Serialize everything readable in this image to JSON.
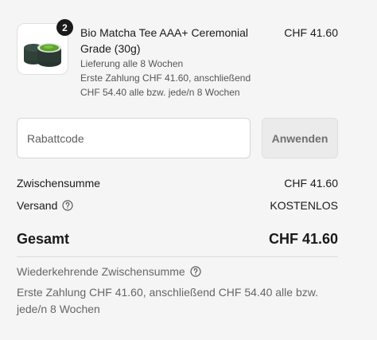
{
  "line_item": {
    "quantity": "2",
    "title": "Bio Matcha Tee AAA+ Ceremonial Grade (30g)",
    "delivery": "Lieferung alle 8 Wochen",
    "payment_line1": "Erste Zahlung CHF 41.60, anschließend",
    "payment_line2": "CHF 54.40 alle bzw. jede/n 8 Wochen",
    "price": "CHF 41.60",
    "image_icon": "matcha-tin-icon"
  },
  "discount": {
    "placeholder": "Rabattcode",
    "value": "",
    "apply_label": "Anwenden"
  },
  "summary": {
    "subtotal_label": "Zwischensumme",
    "subtotal_value": "CHF 41.60",
    "shipping_label": "Versand",
    "shipping_value": "KOSTENLOS",
    "total_label": "Gesamt",
    "total_value": "CHF 41.60"
  },
  "recurring": {
    "label": "Wiederkehrende Zwischensumme",
    "text": "Erste Zahlung CHF 41.60, anschließend CHF 54.40 alle bzw. jede/n 8 Wochen"
  },
  "colors": {
    "background": "#f5f5f5",
    "badge": "#1a1a1a",
    "matcha_green": "#5aa52a"
  }
}
